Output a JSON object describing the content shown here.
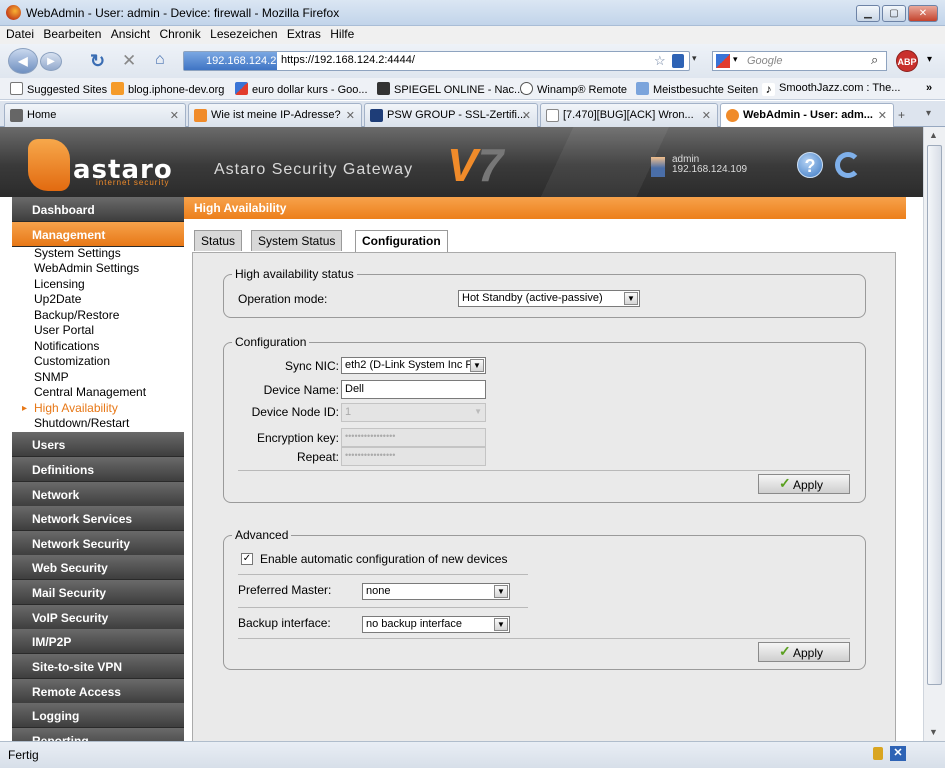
{
  "window": {
    "title": "WebAdmin - User: admin - Device: firewall - Mozilla Firefox"
  },
  "menu": [
    "Datei",
    "Bearbeiten",
    "Ansicht",
    "Chronik",
    "Lesezeichen",
    "Extras",
    "Hilfe"
  ],
  "url": {
    "identity": "192.168.124.2",
    "address": "https://192.168.124.2:4444/"
  },
  "search": {
    "placeholder": "Google"
  },
  "bookmarks": [
    "Suggested Sites",
    "blog.iphone-dev.org",
    "euro dollar kurs - Goo...",
    "SPIEGEL ONLINE - Nac...",
    "Winamp® Remote",
    "Meistbesuchte Seiten",
    "SmoothJazz.com : The..."
  ],
  "browser_tabs": [
    {
      "label": "Home"
    },
    {
      "label": "Wie ist meine IP-Adresse?"
    },
    {
      "label": "PSW GROUP - SSL-Zertifi..."
    },
    {
      "label": "[7.470][BUG][ACK] Wron..."
    },
    {
      "label": "WebAdmin - User: adm..."
    }
  ],
  "header": {
    "logo": "astaro",
    "logo_sub": "internet security",
    "product": "Astaro Security Gateway",
    "version_prefix": "V",
    "version_num": "7",
    "user": "admin",
    "ip": "192.168.124.109",
    "help": "?"
  },
  "sidebar": {
    "dashboard": "Dashboard",
    "management": "Management",
    "management_items": [
      "System Settings",
      "WebAdmin Settings",
      "Licensing",
      "Up2Date",
      "Backup/Restore",
      "User Portal",
      "Notifications",
      "Customization",
      "SNMP",
      "Central Management",
      "High Availability",
      "Shutdown/Restart"
    ],
    "groups": [
      "Users",
      "Definitions",
      "Network",
      "Network Services",
      "Network Security",
      "Web Security",
      "Mail Security",
      "VoIP Security",
      "IM/P2P",
      "Site-to-site VPN",
      "Remote Access",
      "Logging",
      "Reporting"
    ]
  },
  "content": {
    "title": "High Availability",
    "tabs": [
      "Status",
      "System Status",
      "Configuration"
    ],
    "ha_status": {
      "legend": "High availability status",
      "mode_label": "Operation mode:",
      "mode_value": "Hot Standby (active-passive)"
    },
    "config": {
      "legend": "Configuration",
      "sync_nic_label": "Sync NIC:",
      "sync_nic_value": "eth2 (D-Link System Inc F",
      "device_name_label": "Device Name:",
      "device_name_value": "Dell",
      "node_id_label": "Device Node ID:",
      "node_id_value": "1",
      "enc_key_label": "Encryption key:",
      "enc_key_value": "••••••••••••••••",
      "repeat_label": "Repeat:",
      "repeat_value": "••••••••••••••••",
      "apply": "Apply"
    },
    "advanced": {
      "legend": "Advanced",
      "auto_config_label": "Enable automatic configuration of new devices",
      "auto_config_checked": "✓",
      "pref_master_label": "Preferred Master:",
      "pref_master_value": "none",
      "backup_iface_label": "Backup interface:",
      "backup_iface_value": "no backup interface",
      "apply": "Apply"
    }
  },
  "status": {
    "text": "Fertig"
  }
}
